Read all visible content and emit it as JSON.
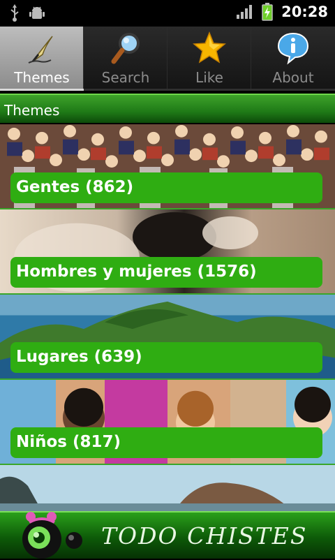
{
  "status_bar": {
    "icons_left": [
      "usb-icon",
      "android-debug-icon"
    ],
    "icons_right": [
      "signal-icon",
      "battery-charging-icon"
    ],
    "time": "20:28"
  },
  "tabs": [
    {
      "label": "Themes",
      "icon": "quill-pen-icon",
      "active": true
    },
    {
      "label": "Search",
      "icon": "magnifier-icon",
      "active": false
    },
    {
      "label": "Like",
      "icon": "star-icon",
      "active": false
    },
    {
      "label": "About",
      "icon": "info-icon",
      "active": false
    }
  ],
  "section": {
    "title": "Themes"
  },
  "themes": [
    {
      "label": "Gentes (862)",
      "image": "crowd-photo"
    },
    {
      "label": "Hombres y mujeres (1576)",
      "image": "couple-photo"
    },
    {
      "label": "Lugares (639)",
      "image": "island-photo"
    },
    {
      "label": "Niños (817)",
      "image": "children-photo"
    },
    {
      "label": "",
      "image": "landscape-photo"
    }
  ],
  "banner": {
    "title": "TODO CHISTES",
    "logo": "alien-mascot-logo"
  },
  "colors": {
    "accent_green": "#2fad12",
    "header_green": "#1f7a17",
    "tab_active": "#a6a6a6"
  }
}
